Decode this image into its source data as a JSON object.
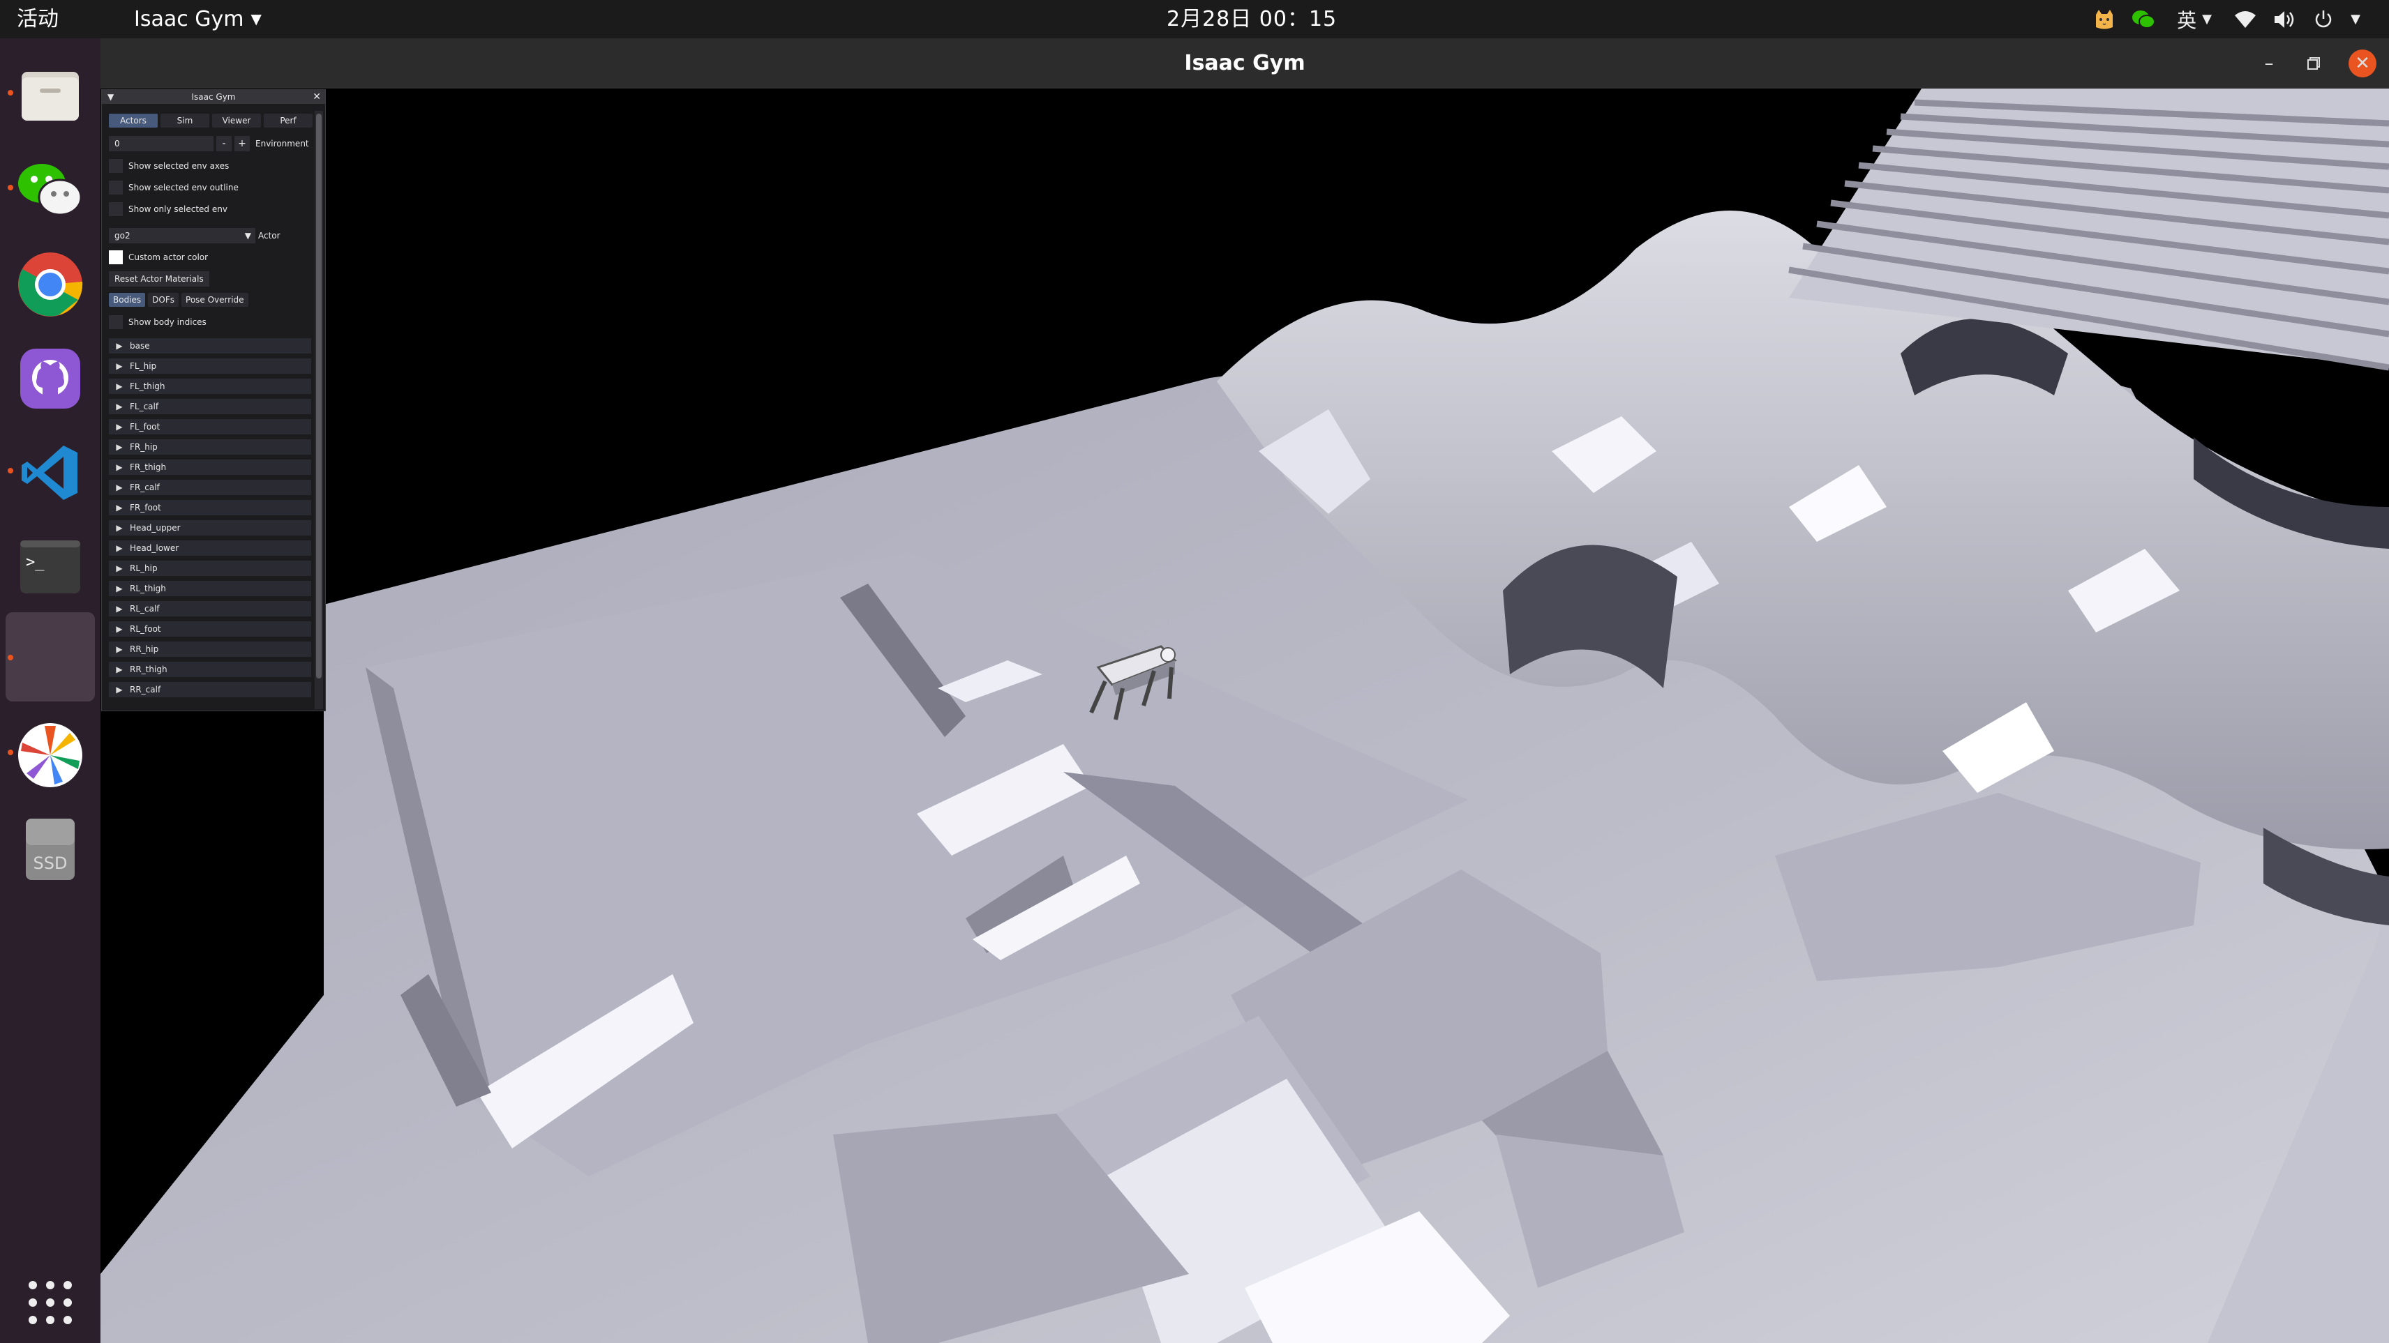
{
  "topbar": {
    "activities": "活动",
    "app_menu": "Isaac Gym",
    "clock": "2月28日  00：15",
    "ime": "英"
  },
  "window": {
    "title": "Isaac Gym"
  },
  "dock": {
    "apps": [
      "files",
      "wechat",
      "chrome",
      "github-desktop",
      "vscode",
      "terminal",
      "isaac-gym",
      "color-picker",
      "ssd-drive"
    ],
    "ssd_label": "SSD"
  },
  "panel": {
    "title": "Isaac Gym",
    "tabs": [
      "Actors",
      "Sim",
      "Viewer",
      "Perf"
    ],
    "active_tab": "Actors",
    "env_value": "0",
    "env_minus": "-",
    "env_plus": "+",
    "env_label": "Environment",
    "checkboxes": [
      "Show selected env axes",
      "Show selected env outline",
      "Show only selected env"
    ],
    "actor_value": "go2",
    "actor_label": "Actor",
    "custom_color_label": "Custom actor color",
    "reset_button": "Reset Actor Materials",
    "subtabs": [
      "Bodies",
      "DOFs",
      "Pose Override"
    ],
    "active_subtab": "Bodies",
    "show_indices_label": "Show body indices",
    "bodies": [
      "base",
      "FL_hip",
      "FL_thigh",
      "FL_calf",
      "FL_foot",
      "FR_hip",
      "FR_thigh",
      "FR_calf",
      "FR_foot",
      "Head_upper",
      "Head_lower",
      "RL_hip",
      "RL_thigh",
      "RL_calf",
      "RL_foot",
      "RR_hip",
      "RR_thigh",
      "RR_calf"
    ]
  },
  "colors": {
    "topbar_bg": "#1b1b1b",
    "dock_bg": "#2a1f2a",
    "accent": "#e95420",
    "panel_bg": "#1c1c1e",
    "panel_tab_active": "#475a7c",
    "terrain": "#b8b8c4"
  }
}
